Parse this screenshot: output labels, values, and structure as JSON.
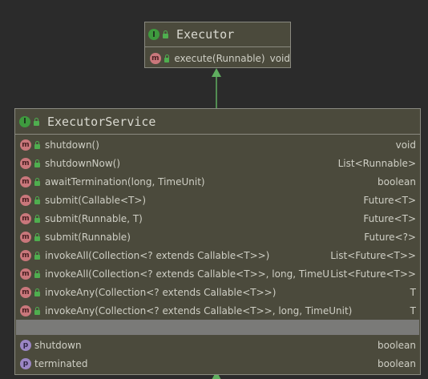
{
  "executor": {
    "interface_badge": "I",
    "title": "Executor",
    "methods": [
      {
        "badge": "m",
        "signature": "execute(Runnable)",
        "return_type": "void"
      }
    ]
  },
  "executor_service": {
    "interface_badge": "I",
    "title": "ExecutorService",
    "methods": [
      {
        "badge": "m",
        "signature": "shutdown()",
        "return_type": "void"
      },
      {
        "badge": "m",
        "signature": "shutdownNow()",
        "return_type": "List<Runnable>"
      },
      {
        "badge": "m",
        "signature": "awaitTermination(long, TimeUnit)",
        "return_type": "boolean"
      },
      {
        "badge": "m",
        "signature": "submit(Callable<T>)",
        "return_type": "Future<T>"
      },
      {
        "badge": "m",
        "signature": "submit(Runnable, T)",
        "return_type": "Future<T>"
      },
      {
        "badge": "m",
        "signature": "submit(Runnable)",
        "return_type": "Future<?>"
      },
      {
        "badge": "m",
        "signature": "invokeAll(Collection<? extends Callable<T>>)",
        "return_type": "List<Future<T>>"
      },
      {
        "badge": "m",
        "signature": "invokeAll(Collection<? extends Callable<T>>, long, TimeUnit)",
        "return_type": "List<Future<T>>"
      },
      {
        "badge": "m",
        "signature": "invokeAny(Collection<? extends Callable<T>>)",
        "return_type": "T"
      },
      {
        "badge": "m",
        "signature": "invokeAny(Collection<? extends Callable<T>>, long, TimeUnit)",
        "return_type": "T"
      }
    ],
    "properties": [
      {
        "badge": "p",
        "name": "shutdown",
        "type": "boolean"
      },
      {
        "badge": "p",
        "name": "terminated",
        "type": "boolean"
      }
    ]
  },
  "colors": {
    "background": "#2b2b2b",
    "box_fill": "#4b4a3c",
    "box_border": "#8a8a80",
    "arrow": "#5fae5f",
    "interface_badge": "#3e9a3e",
    "method_badge": "#c9777b",
    "property_badge": "#9b86c4"
  }
}
